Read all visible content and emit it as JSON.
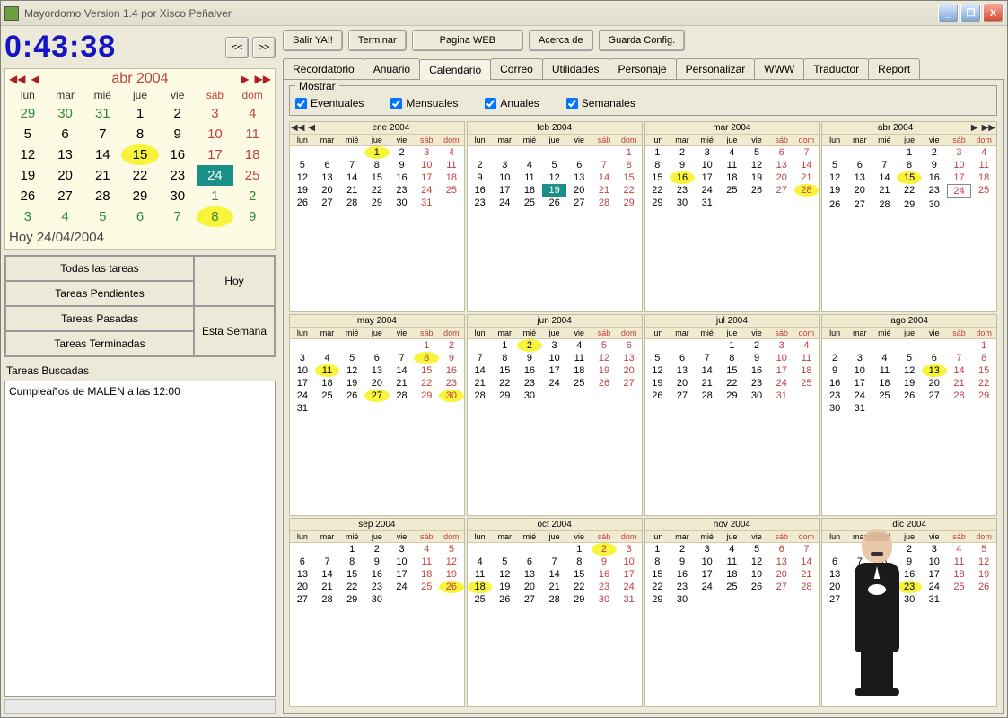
{
  "window_title": "Mayordomo Version 1.4  por Xisco Peñalver",
  "clock": "0:43:38",
  "nav_prev": "<<",
  "nav_next": ">>",
  "top_buttons": [
    "Salir YA!!",
    "Terminar",
    "Pagina WEB",
    "Acerca de",
    "Guarda Config."
  ],
  "tabs": [
    "Recordatorio",
    "Anuario",
    "Calendario",
    "Correo",
    "Utilidades",
    "Personaje",
    "Personalizar",
    "WWW",
    "Traductor",
    "Report"
  ],
  "active_tab": "Calendario",
  "mostrar_label": "Mostrar",
  "filters": [
    "Eventuales",
    "Mensuales",
    "Anuales",
    "Semanales"
  ],
  "big_cal": {
    "title": "abr 2004",
    "dow": [
      "lun",
      "mar",
      "mié",
      "jue",
      "vie",
      "sáb",
      "dom"
    ],
    "weeks": [
      [
        {
          "d": 29,
          "out": true
        },
        {
          "d": 30,
          "out": true
        },
        {
          "d": 31,
          "out": true
        },
        {
          "d": 1
        },
        {
          "d": 2
        },
        {
          "d": 3,
          "we": true
        },
        {
          "d": 4,
          "we": true
        }
      ],
      [
        {
          "d": 5
        },
        {
          "d": 6
        },
        {
          "d": 7
        },
        {
          "d": 8
        },
        {
          "d": 9
        },
        {
          "d": 10,
          "we": true
        },
        {
          "d": 11,
          "we": true
        }
      ],
      [
        {
          "d": 12
        },
        {
          "d": 13
        },
        {
          "d": 14
        },
        {
          "d": 15,
          "hl": true
        },
        {
          "d": 16
        },
        {
          "d": 17,
          "we": true
        },
        {
          "d": 18,
          "we": true
        }
      ],
      [
        {
          "d": 19
        },
        {
          "d": 20
        },
        {
          "d": 21
        },
        {
          "d": 22
        },
        {
          "d": 23
        },
        {
          "d": 24,
          "sel": true,
          "we": true
        },
        {
          "d": 25,
          "we": true
        }
      ],
      [
        {
          "d": 26
        },
        {
          "d": 27
        },
        {
          "d": 28
        },
        {
          "d": 29
        },
        {
          "d": 30
        },
        {
          "d": 1,
          "out": true
        },
        {
          "d": 2,
          "out": true
        }
      ],
      [
        {
          "d": 3,
          "out": true
        },
        {
          "d": 4,
          "out": true
        },
        {
          "d": 5,
          "out": true
        },
        {
          "d": 6,
          "out": true
        },
        {
          "d": 7,
          "out": true
        },
        {
          "d": 8,
          "out": true,
          "hl": true
        },
        {
          "d": 9,
          "out": true
        }
      ]
    ],
    "today": "Hoy 24/04/2004"
  },
  "task_buttons": {
    "all": "Todas las tareas",
    "pending": "Tareas Pendientes",
    "past": "Tareas Pasadas",
    "done": "Tareas Terminadas",
    "today": "Hoy",
    "week": "Esta Semana"
  },
  "search_label": "Tareas Buscadas",
  "result_text": "Cumpleaños de MALEN a las 12:00",
  "year_nav": {
    "year": 2004
  },
  "mini_dow": [
    "lun",
    "mar",
    "mié",
    "jue",
    "vie",
    "sáb",
    "dom"
  ],
  "months": [
    {
      "title": "ene 2004",
      "nav": "left",
      "start": 3,
      "days": 31,
      "hl": [
        1
      ],
      "red": [
        31
      ]
    },
    {
      "title": "feb 2004",
      "nav": "",
      "start": 6,
      "days": 29,
      "sel": [
        19
      ],
      "red": [
        29
      ]
    },
    {
      "title": "mar 2004",
      "nav": "",
      "start": 0,
      "days": 31,
      "hl": [
        16,
        28
      ]
    },
    {
      "title": "abr 2004",
      "nav": "right",
      "start": 3,
      "days": 30,
      "hl": [
        15
      ],
      "boxed": [
        24
      ]
    },
    {
      "title": "may 2004",
      "nav": "",
      "start": 5,
      "days": 31,
      "hl": [
        8,
        11,
        27,
        30
      ]
    },
    {
      "title": "jun 2004",
      "nav": "",
      "start": 1,
      "days": 30,
      "hl": [
        2
      ]
    },
    {
      "title": "jul 2004",
      "nav": "",
      "start": 3,
      "days": 31
    },
    {
      "title": "ago 2004",
      "nav": "",
      "start": 6,
      "days": 31,
      "hl": [
        13
      ]
    },
    {
      "title": "sep 2004",
      "nav": "",
      "start": 2,
      "days": 30,
      "hl": [
        26
      ]
    },
    {
      "title": "oct 2004",
      "nav": "",
      "start": 4,
      "days": 31,
      "hl": [
        2,
        18
      ]
    },
    {
      "title": "nov 2004",
      "nav": "",
      "start": 0,
      "days": 30
    },
    {
      "title": "dic 2004",
      "nav": "",
      "start": 2,
      "days": 31,
      "hl": [
        23
      ]
    }
  ]
}
